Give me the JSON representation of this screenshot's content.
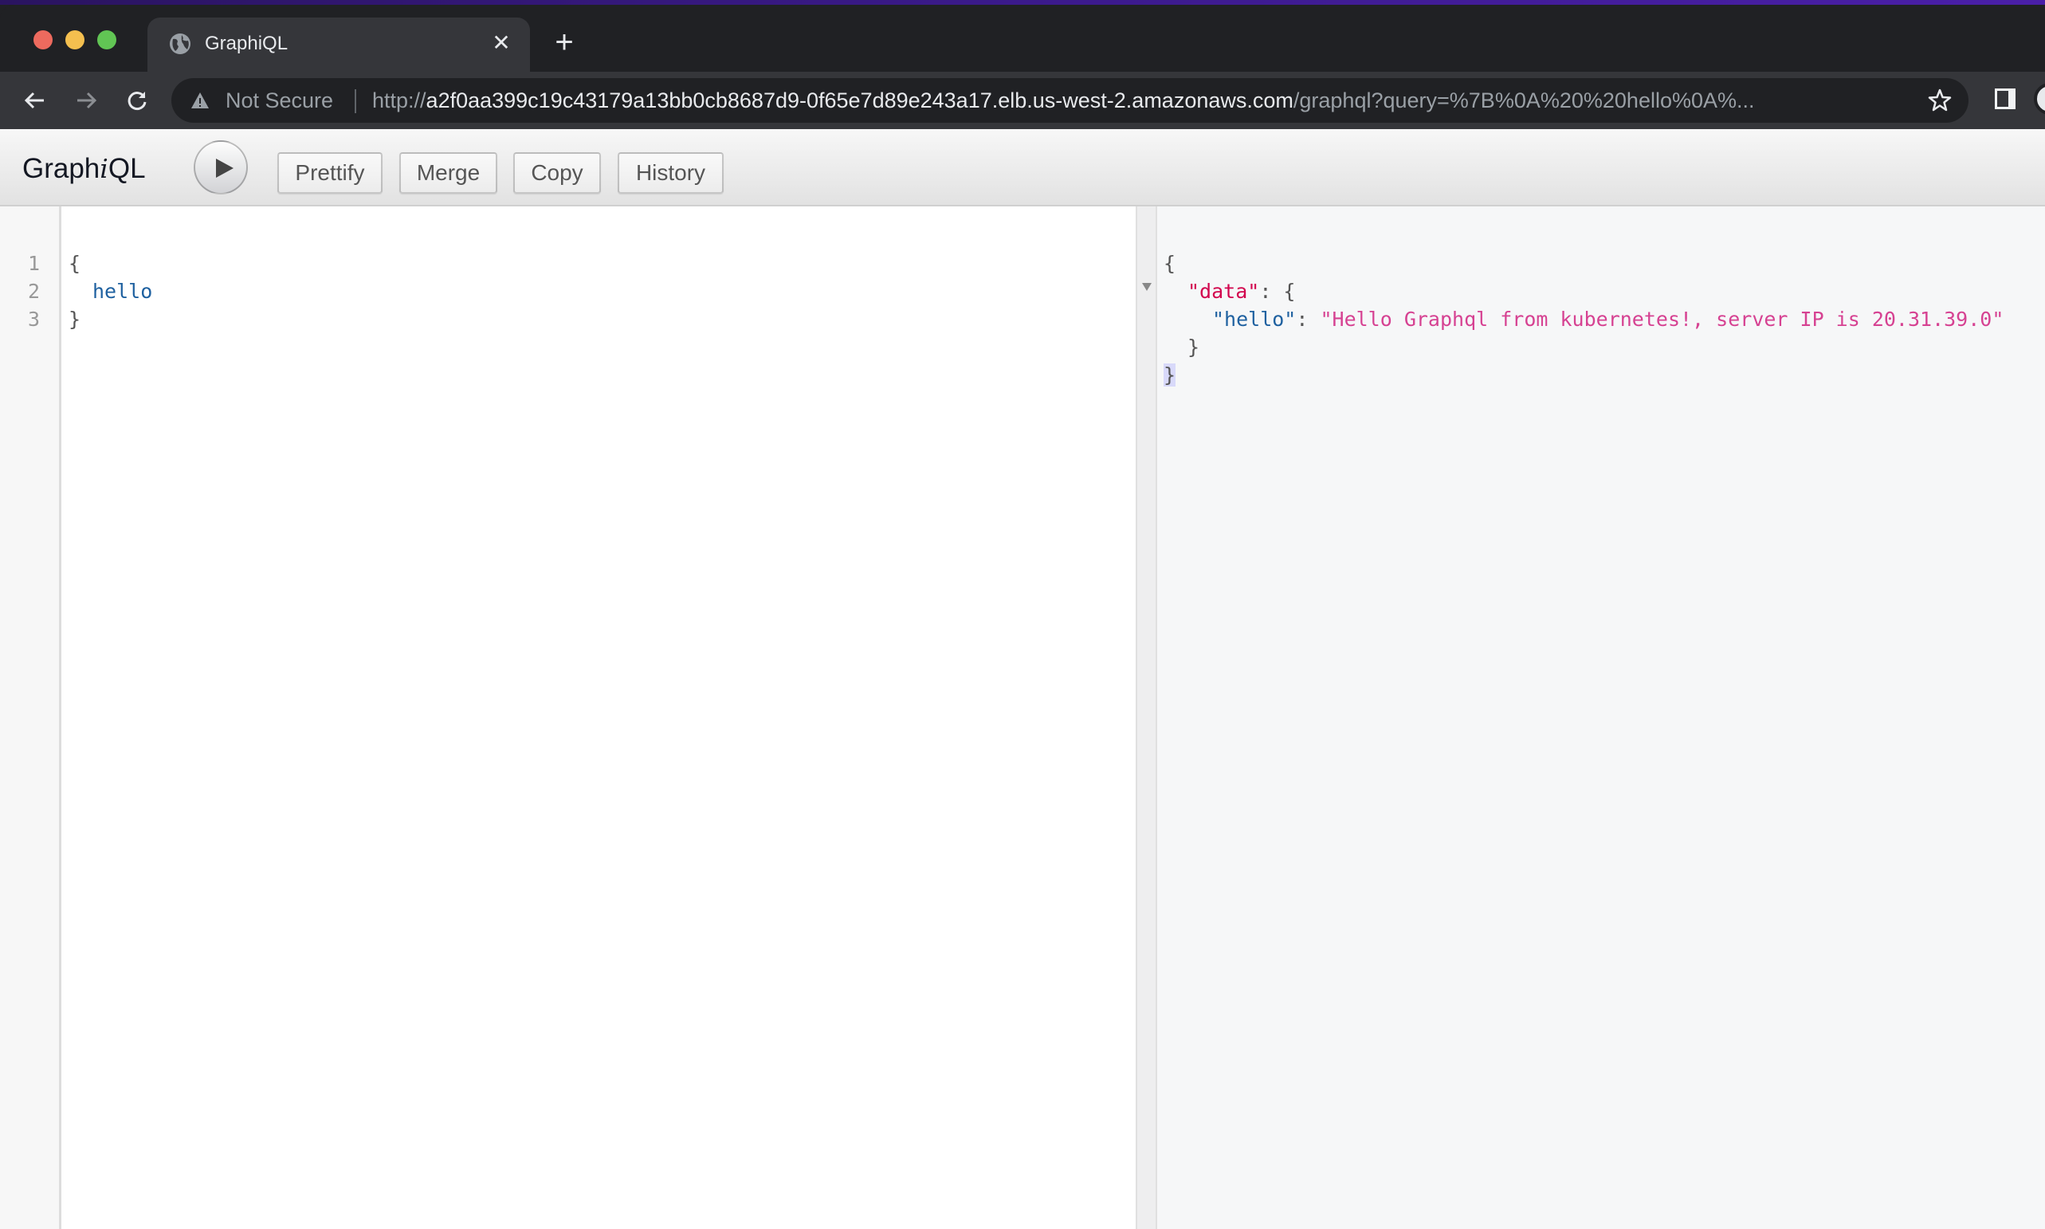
{
  "browser": {
    "tab": {
      "title": "GraphiQL",
      "icon": "globe-icon",
      "close_symbol": "✕"
    },
    "new_tab_symbol": "+",
    "security_label": "Not Secure",
    "url": {
      "scheme": "http://",
      "host": "a2f0aa399c19c43179a13bb0cb8687d9-0f65e7d89e243a17.elb.us-west-2.amazonaws.com",
      "path": "/graphql?query=%7B%0A%20%20hello%0A%..."
    }
  },
  "graphiql": {
    "title_prefix": "Graph",
    "title_italic": "i",
    "title_suffix": "QL",
    "buttons": {
      "prettify": "Prettify",
      "merge": "Merge",
      "copy": "Copy",
      "history": "History"
    },
    "query": {
      "line_numbers": [
        "1",
        "2",
        "3"
      ],
      "lines": [
        "{",
        "hello",
        "}"
      ]
    },
    "result": {
      "open_brace": "{",
      "data_key": "\"data\"",
      "colon_brace": ": {",
      "hello_key": "\"hello\"",
      "colon": ": ",
      "hello_value": "\"Hello Graphql from kubernetes!, server IP is 20.31.39.0\"",
      "inner_close": "}",
      "outer_close": "}"
    }
  }
}
